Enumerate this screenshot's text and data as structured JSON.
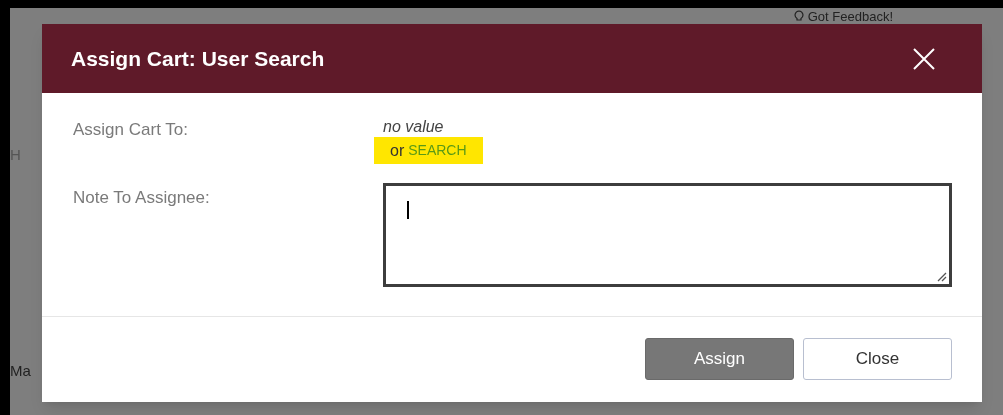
{
  "background": {
    "feedback_link": "Got Feedback!",
    "fragments": [
      "H",
      "Ma"
    ]
  },
  "dialog": {
    "title": "Assign Cart: User Search",
    "assign_to": {
      "label": "Assign Cart To:",
      "value": "no value",
      "prefix": "or",
      "link": "SEARCH",
      "highlighted": true
    },
    "note": {
      "label": "Note To Assignee:",
      "focused": true
    },
    "buttons": [
      {
        "label": "Assign",
        "kind": "primary"
      },
      {
        "label": "Close",
        "kind": "secondary"
      }
    ]
  }
}
